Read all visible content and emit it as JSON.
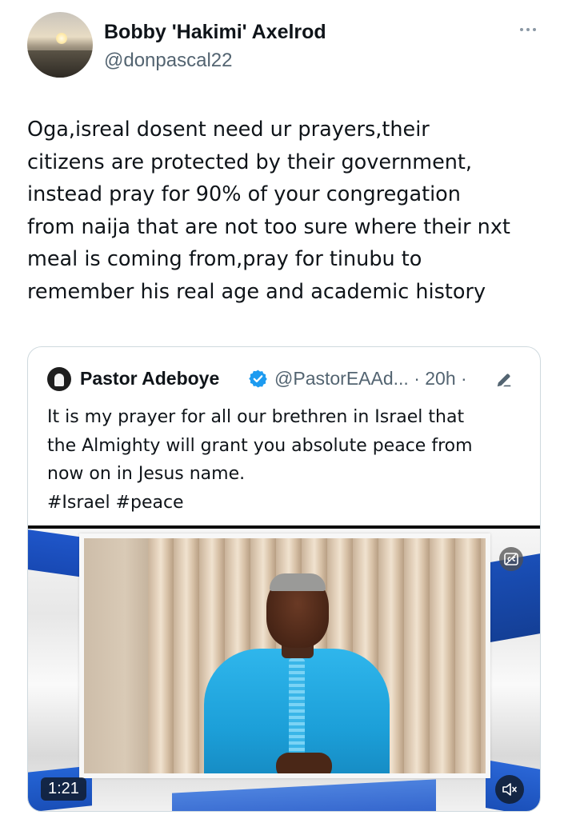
{
  "author": {
    "name": "Bobby 'Hakimi' Axelrod",
    "handle": "@donpascal22"
  },
  "tweet": {
    "lines": [
      "Oga,isreal dosent need ur prayers,their",
      "citizens are protected by their government,",
      "instead pray for 90% of your congregation",
      "from naija that are not too sure where their nxt",
      "meal is coming from,pray for tinubu to",
      "remember his real age and academic history"
    ]
  },
  "quoted": {
    "name": "Pastor Adeboye",
    "meta": "@PastorEAAd... · 20h ·",
    "lines": [
      "It is my prayer for all our brethren in Israel that",
      "the Almighty will grant you absolute peace from",
      "now on in Jesus name.",
      "#Israel #peace"
    ],
    "video": {
      "duration": "1:21"
    }
  },
  "icons": {
    "more": "more-horizontal-icon",
    "verified": "verified-badge-icon",
    "edit": "edit-pencil-icon",
    "captions": "closed-captions-icon",
    "mute": "volume-muted-icon"
  },
  "colors": {
    "text": "#0f1419",
    "secondary": "#536471",
    "verified": "#1d9bf0",
    "border": "#cfd9de"
  }
}
